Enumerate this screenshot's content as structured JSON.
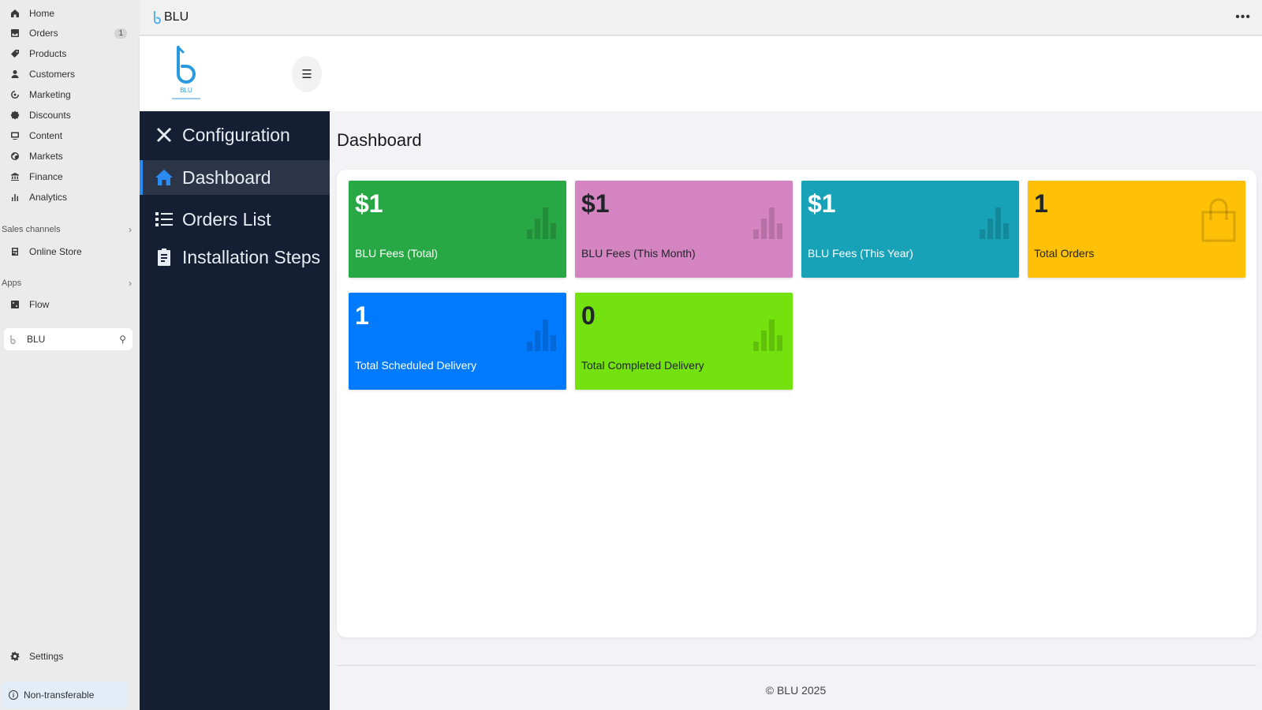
{
  "admin_sidebar": {
    "items": [
      {
        "label": "Home",
        "icon": "home-icon"
      },
      {
        "label": "Orders",
        "icon": "orders-icon",
        "badge": "1"
      },
      {
        "label": "Products",
        "icon": "tag-icon"
      },
      {
        "label": "Customers",
        "icon": "person-icon"
      },
      {
        "label": "Marketing",
        "icon": "target-icon"
      },
      {
        "label": "Discounts",
        "icon": "discount-icon"
      },
      {
        "label": "Content",
        "icon": "content-icon"
      },
      {
        "label": "Markets",
        "icon": "globe-icon"
      },
      {
        "label": "Finance",
        "icon": "bank-icon"
      },
      {
        "label": "Analytics",
        "icon": "bar-chart-icon"
      }
    ],
    "sales_channels": {
      "title": "Sales channels",
      "items": [
        {
          "label": "Online Store",
          "icon": "store-icon"
        }
      ]
    },
    "apps": {
      "title": "Apps",
      "items": [
        {
          "label": "Flow",
          "icon": "flow-icon"
        },
        {
          "label": "BLU",
          "icon": "blu-app-icon"
        }
      ]
    },
    "settings_label": "Settings",
    "footer_notice": "Non-transferable"
  },
  "app": {
    "title": "BLU",
    "logo_text": "BLU",
    "sidebar": [
      {
        "label": "Configuration",
        "icon": "tools-icon"
      },
      {
        "label": "Dashboard",
        "icon": "home-icon",
        "active": true
      },
      {
        "label": "Orders List",
        "icon": "list-icon"
      },
      {
        "label": "Installation Steps",
        "icon": "clipboard-icon"
      }
    ],
    "page_title": "Dashboard",
    "cards": [
      {
        "value": "$1",
        "label": "BLU Fees (Total)",
        "color": "#28a745",
        "text_color": "#ffffff",
        "icon": "bar-chart-icon"
      },
      {
        "value": "$1",
        "label": "BLU Fees (This Month)",
        "color": "#d584c2",
        "text_color": "#212529",
        "icon": "bar-chart-icon"
      },
      {
        "value": "$1",
        "label": "BLU Fees (This Year)",
        "color": "#17a2b8",
        "text_color": "#ffffff",
        "icon": "bar-chart-icon"
      },
      {
        "value": "1",
        "label": "Total Orders",
        "color": "#ffc107",
        "text_color": "#212529",
        "icon": "shopping-bag-icon"
      },
      {
        "value": "1",
        "label": "Total Scheduled Delivery",
        "color": "#007bff",
        "text_color": "#ffffff",
        "icon": "bar-chart-icon"
      },
      {
        "value": "0",
        "label": "Total Completed Delivery",
        "color": "#74e20f",
        "text_color": "#212529",
        "icon": "bar-chart-icon"
      }
    ],
    "footer": "BLU 2025"
  }
}
